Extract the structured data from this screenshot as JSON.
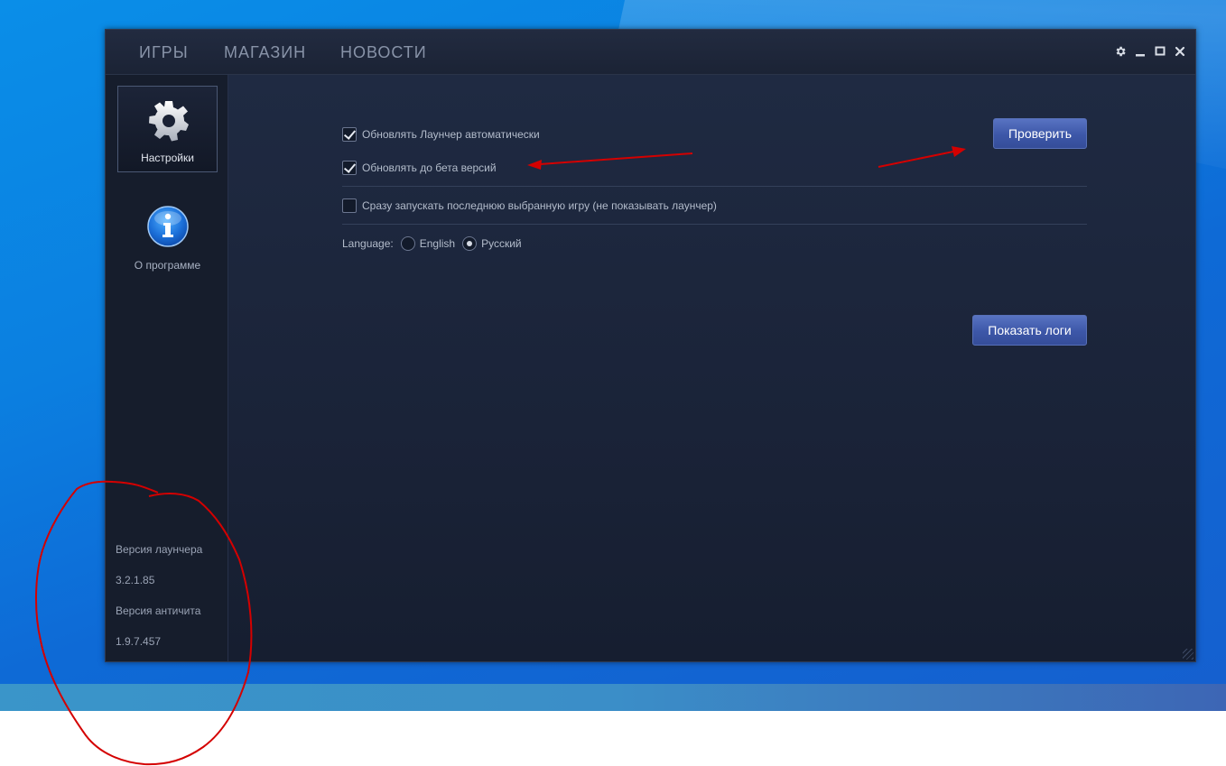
{
  "nav": {
    "tabs": [
      {
        "label": "ИГРЫ"
      },
      {
        "label": "МАГАЗИН"
      },
      {
        "label": "НОВОСТИ"
      }
    ]
  },
  "window_controls": {
    "settings_icon": "gear-icon",
    "minimize_icon": "minimize-icon",
    "maximize_icon": "maximize-icon",
    "close_icon": "close-icon"
  },
  "sidebar": {
    "items": [
      {
        "label": "Настройки",
        "icon": "gear-icon",
        "active": true
      },
      {
        "label": "О программе",
        "icon": "info-icon",
        "active": false
      }
    ],
    "launcher_version_label": "Версия лаунчера",
    "launcher_version": "3.2.1.85",
    "anticheat_version_label": "Версия античита",
    "anticheat_version": "1.9.7.457"
  },
  "settings": {
    "auto_update_label": "Обновлять Лаунчер автоматически",
    "auto_update_checked": true,
    "beta_update_label": "Обновлять до бета версий",
    "beta_update_checked": true,
    "quick_launch_label": "Сразу запускать последнюю выбранную игру (не показывать лаунчер)",
    "quick_launch_checked": false,
    "language_label": "Language:",
    "language_options": [
      {
        "label": "English",
        "selected": false
      },
      {
        "label": "Русский",
        "selected": true
      }
    ],
    "check_button_label": "Проверить",
    "show_logs_button_label": "Показать логи"
  },
  "colors": {
    "desktop": "#0b7fe0",
    "window_bg": "#1b2334",
    "button": "#3d57a8",
    "annotation": "#d40000"
  }
}
